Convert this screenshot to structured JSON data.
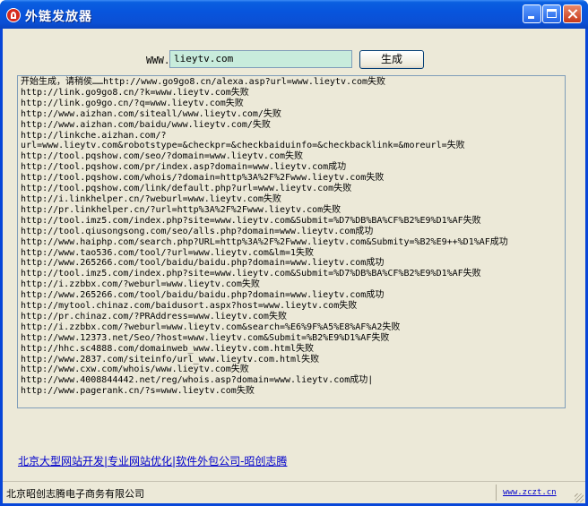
{
  "window": {
    "title": "外链发放器"
  },
  "form": {
    "url_label": "WWW.",
    "url_value": "lieytv.com",
    "generate_label": "生成"
  },
  "log": {
    "lines": [
      "开始生成，请稍侯……http://www.go9go8.cn/alexa.asp?url=www.lieytv.com失败",
      "http://link.go9go8.cn/?k=www.lieytv.com失败",
      "http://link.go9go.cn/?q=www.lieytv.com失败",
      "http://www.aizhan.com/siteall/www.lieytv.com/失败",
      "http://www.aizhan.com/baidu/www.lieytv.com/失败",
      "http://linkche.aizhan.com/?",
      "url=www.lieytv.com&robotstype=&checkpr=&checkbaiduinfo=&checkbacklink=&moreurl=失败",
      "http://tool.pqshow.com/seo/?domain=www.lieytv.com失败",
      "http://tool.pqshow.com/pr/index.asp?domain=www.lieytv.com成功",
      "http://tool.pqshow.com/whois/?domain=http%3A%2F%2Fwww.lieytv.com失败",
      "http://tool.pqshow.com/link/default.php?url=www.lieytv.com失败",
      "http://i.linkhelper.cn/?weburl=www.lieytv.com失败",
      "http://pr.linkhelper.cn/?url=http%3A%2F%2Fwww.lieytv.com失败",
      "http://tool.imz5.com/index.php?site=www.lieytv.com&Submit=%D7%DB%BA%CF%B2%E9%D1%AF失败",
      "http://tool.qiusongsong.com/seo/alls.php?domain=www.lieytv.com成功",
      "http://www.haiphp.com/search.php?URL=http%3A%2F%2Fwww.lieytv.com&Submity=%B2%E9++%D1%AF成功",
      "http://www.tao536.com/tool/?url=www.lieytv.com&lm=1失败",
      "http://www.265266.com/tool/baidu/baidu.php?domain=www.lieytv.com成功",
      "http://tool.imz5.com/index.php?site=www.lieytv.com&Submit=%D7%DB%BA%CF%B2%E9%D1%AF失败",
      "http://i.zzbbx.com/?weburl=www.lieytv.com失败",
      "http://www.265266.com/tool/baidu/baidu.php?domain=www.lieytv.com成功",
      "http://mytool.chinaz.com/baidusort.aspx?host=www.lieytv.com失败",
      "http://pr.chinaz.com/?PRAddress=www.lieytv.com失败",
      "http://i.zzbbx.com/?weburl=www.lieytv.com&search=%E6%9F%A5%E8%AF%A2失败",
      "http://www.12373.net/Seo/?host=www.lieytv.com&Submit=%B2%E9%D1%AF失败",
      "http://hhc.sc4888.com/domainweb_www.lieytv.com.html失败",
      "http://www.2837.com/siteinfo/url_www.lieytv.com.html失败",
      "http://www.cxw.com/whois/www.lieytv.com失败",
      "http://www.4008844442.net/reg/whois.asp?domain=www.lieytv.com成功|",
      "http://www.pagerank.cn/?s=www.lieytv.com失败"
    ]
  },
  "footer": {
    "link_text": "北京大型网站开发|专业网站优化|软件外包公司-昭创志腾"
  },
  "statusbar": {
    "company": "北京昭创志腾电子商务有限公司",
    "url": "www.zczt.cn"
  }
}
